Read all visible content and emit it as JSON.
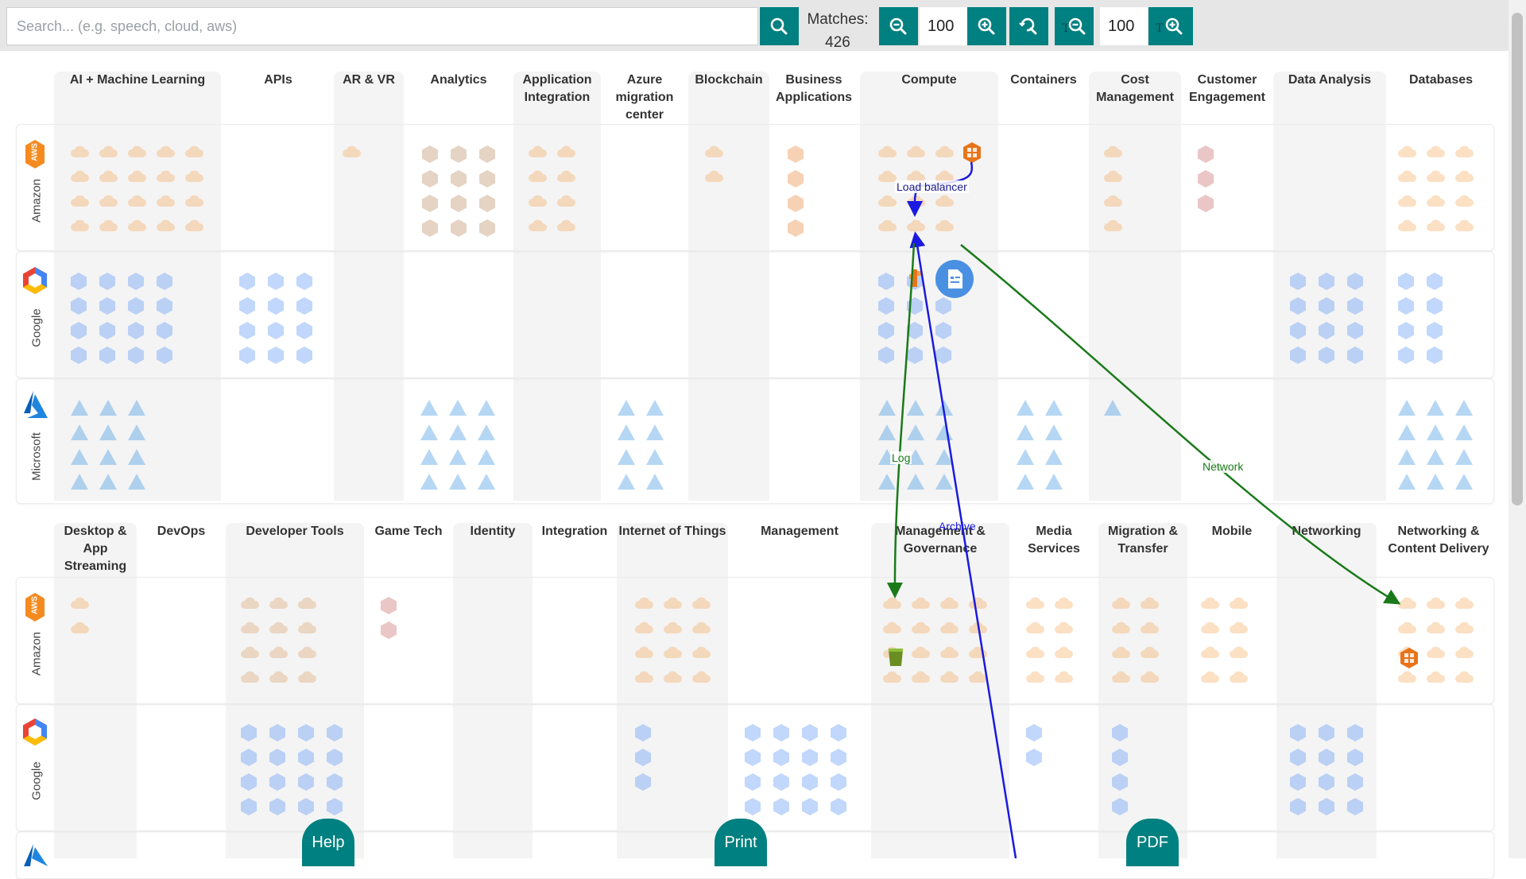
{
  "search": {
    "placeholder": "Search... (e.g. speech, cloud, aws)",
    "value": ""
  },
  "toolbar": {
    "search_icon": "magnifier-icon",
    "matches_label": "Matches:",
    "matches_count": "426",
    "zoom_value": "100",
    "text_zoom_value": "100"
  },
  "section1": {
    "columns": [
      "AI + Machine Learning",
      "APIs",
      "AR & VR",
      "Analytics",
      "Application Integration",
      "Azure migration center",
      "Blockchain",
      "Business Applications",
      "Compute",
      "Containers",
      "Cost Management",
      "Customer Engagement",
      "Data Analysis",
      "Databases"
    ]
  },
  "section2": {
    "columns": [
      "Desktop & App Streaming",
      "DevOps",
      "Developer Tools",
      "Game Tech",
      "Identity",
      "Integration",
      "Internet of Things",
      "Management",
      "Management & Governance",
      "Media Services",
      "Migration & Transfer",
      "Mobile",
      "Networking",
      "Networking & Content Delivery"
    ]
  },
  "providers": [
    "Amazon",
    "Google",
    "Microsoft"
  ],
  "provider_logos": {
    "amazon": "AWS",
    "google": "google-cloud-hexagon-icon",
    "microsoft": "azure-a-icon"
  },
  "connections": {
    "load_balancer": "Load balancer",
    "log": "Log",
    "network": "Network",
    "archive": "Archive"
  },
  "colors": {
    "teal": "#008080",
    "aws_orange": "#f58a1f",
    "blue_line": "#1a1ae0",
    "green_line": "#1a7a1a",
    "node_blue": "#4a90e2"
  },
  "footer": {
    "help": "Help",
    "print": "Print",
    "pdf": "PDF"
  }
}
